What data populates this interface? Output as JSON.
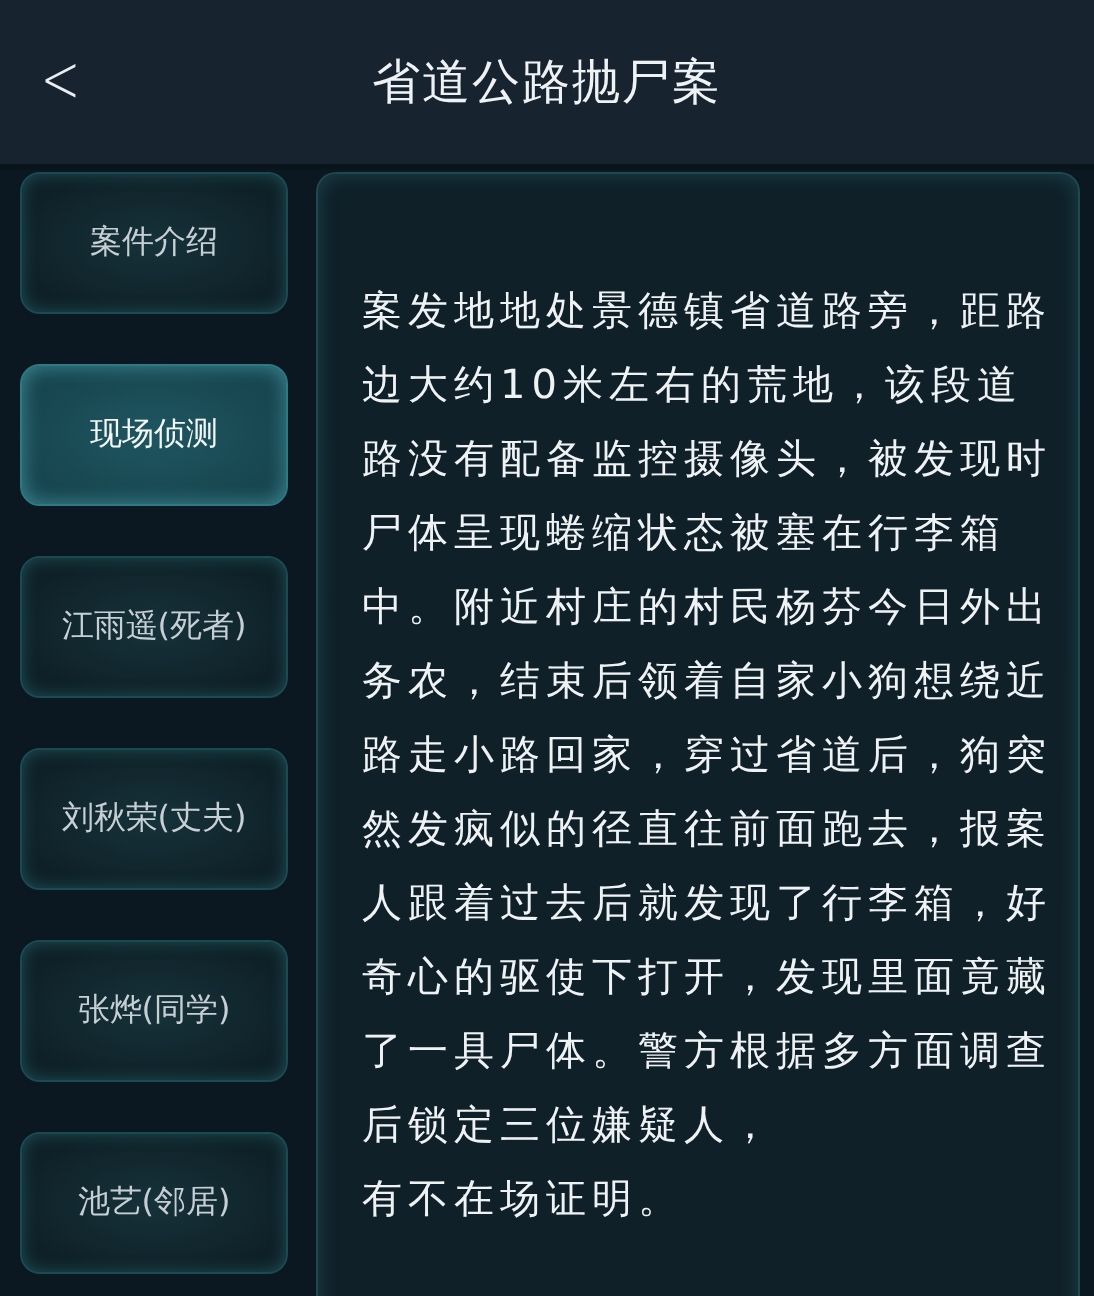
{
  "header": {
    "back": "<",
    "title": "省道公路抛尸案"
  },
  "sidebar": {
    "items": [
      {
        "label": "案件介绍",
        "selected": false
      },
      {
        "label": "现场侦测",
        "selected": true
      },
      {
        "label": "江雨遥(死者)",
        "selected": false
      },
      {
        "label": "刘秋荣(丈夫)",
        "selected": false
      },
      {
        "label": "张烨(同学)",
        "selected": false
      },
      {
        "label": "池艺(邻居)",
        "selected": false
      }
    ]
  },
  "content": {
    "paragraphs": [
      "案发地地处景德镇省道路旁，距路边大约10米左右的荒地，该段道路没有配备监控摄像头，被发现时尸体呈现蜷缩状态被塞在行李箱中。附近村庄的村民杨芬今日外出务农，结束后领着自家小狗想绕近路走小路回家，穿过省道后，狗突然发疯似的径直往前面跑去，报案人跟着过去后就发现了行李箱，好奇心的驱使下打开，发现里面竟藏了一具尸体。警方根据多方面调查后锁定三位嫌疑人，",
      "有不在场证明。"
    ]
  }
}
